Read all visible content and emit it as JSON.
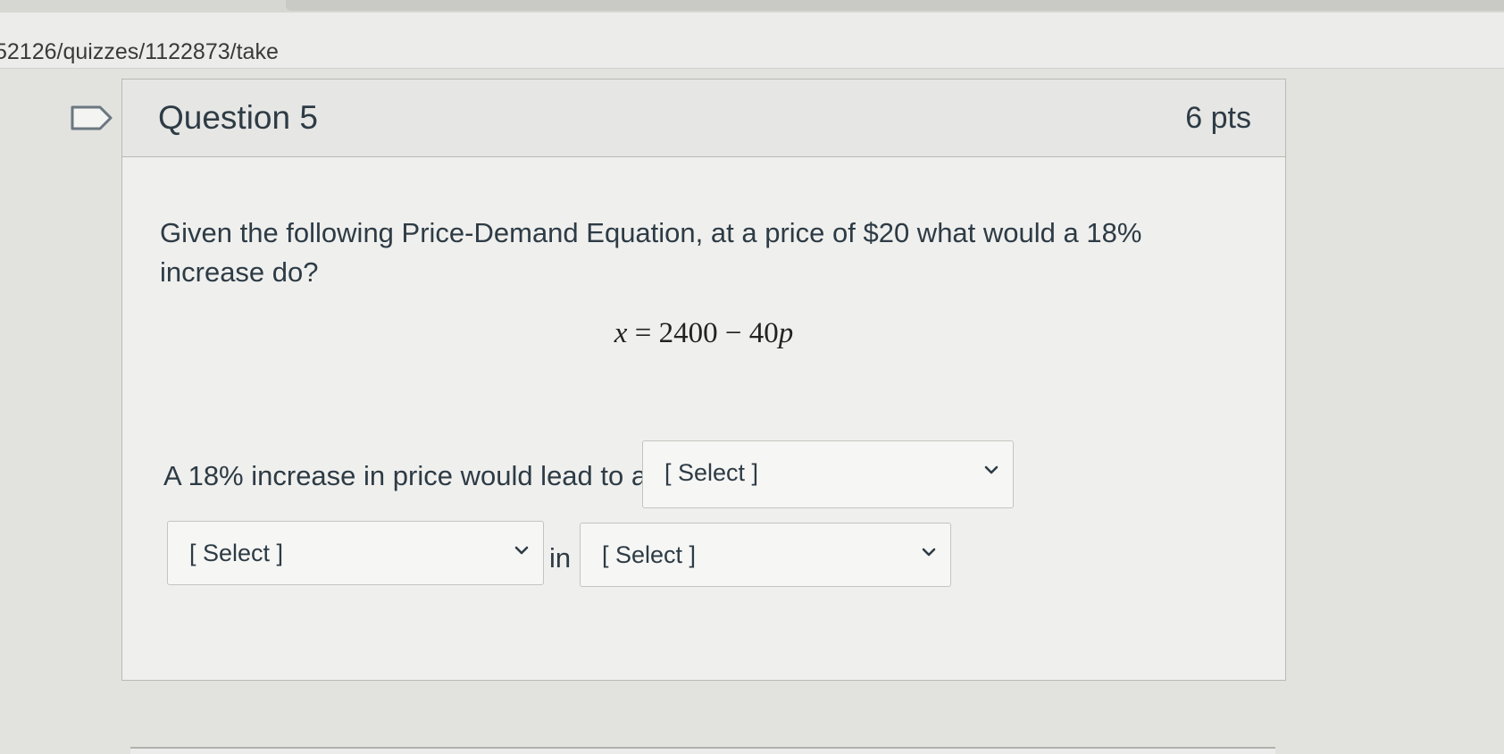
{
  "browser": {
    "url": "52126/quizzes/1122873/take"
  },
  "question": {
    "title": "Question 5",
    "points": "6 pts",
    "flag_icon": "flag-icon",
    "text": "Given the following Price-Demand Equation, at a price of $20 what would a 18% increase do?",
    "equation": {
      "lhs": "x",
      "operator": " = ",
      "constant": "2400",
      "minus": " − ",
      "coefficient": "40",
      "variable": "p"
    },
    "answer_prompt": "A 18% increase in price would lead to a",
    "connector": "in",
    "selects": [
      {
        "value": "[ Select ]"
      },
      {
        "value": "[ Select ]"
      },
      {
        "value": "[ Select ]"
      }
    ]
  }
}
